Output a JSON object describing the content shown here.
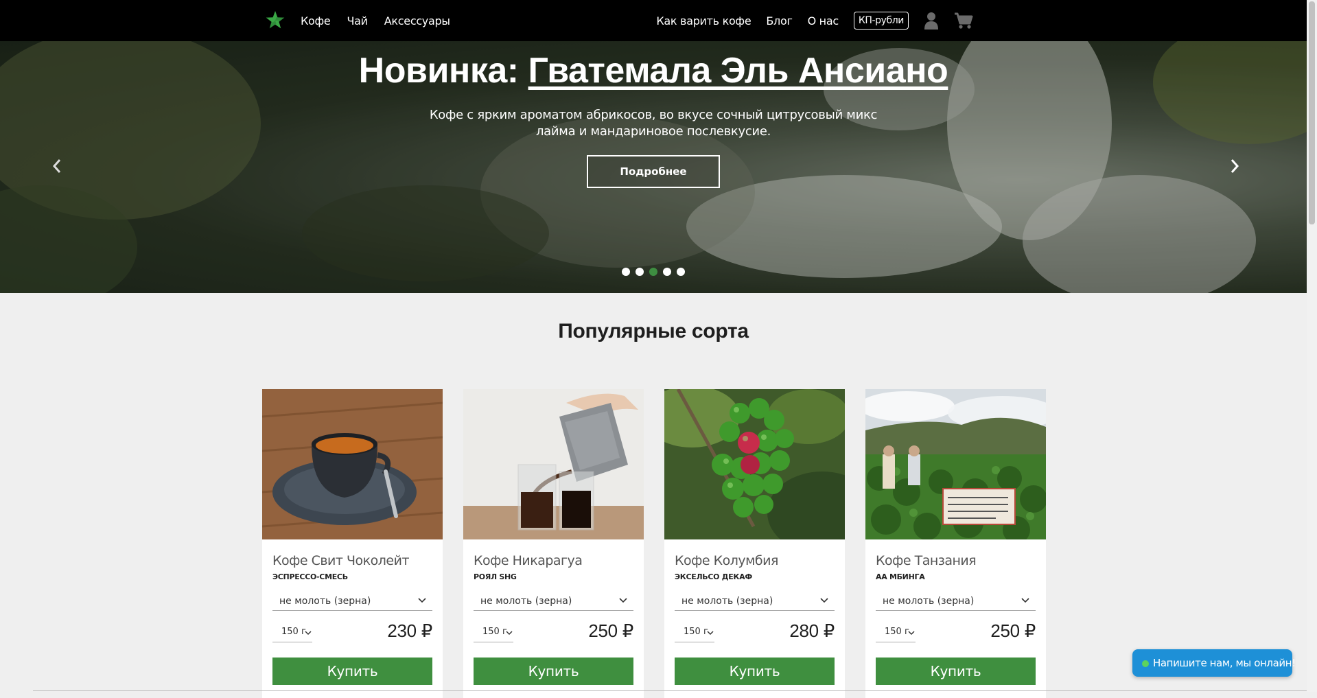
{
  "header": {
    "nav_left": [
      "Кофе",
      "Чай",
      "Аксессуары"
    ],
    "nav_right": [
      "Как варить кофе",
      "Блог",
      "О нас"
    ],
    "currency_label": "КП-рубли",
    "logo_icon": "green-leaf-star-icon",
    "account_icon": "user-icon",
    "cart_icon": "cart-icon"
  },
  "hero": {
    "title_prefix": "Новинка:",
    "title_link": "Гватемала Эль Ансиано",
    "description": "Кофе с ярким ароматом абрикосов, во вкусе сочный цитрусовый микс лайма и мандариновое послевкусие.",
    "button_label": "Подробнее",
    "slides_total": 5,
    "active_slide": 3,
    "prev_icon": "chevron-left-icon",
    "next_icon": "chevron-right-icon"
  },
  "popular": {
    "title": "Популярные сорта",
    "products": [
      {
        "name": "Кофе Свит Чоколейт",
        "subtitle": "ЭСПРЕССО-СМЕСЬ",
        "grind": "не молоть (зерна)",
        "weight": "150 г",
        "price": "230 ₽",
        "buy_label": "Купить",
        "image": "espresso-cup-photo"
      },
      {
        "name": "Кофе Никарагуа",
        "subtitle": "РОЯЛ SHG",
        "grind": "не молоть (зерна)",
        "weight": "150 г",
        "price": "250 ₽",
        "buy_label": "Купить",
        "image": "french-press-pour-photo"
      },
      {
        "name": "Кофе Колумбия",
        "subtitle": "ЭКСЕЛЬСО ДЕКАФ",
        "grind": "не молоть (зерна)",
        "weight": "150 г",
        "price": "280 ₽",
        "buy_label": "Купить",
        "image": "coffee-cherries-photo"
      },
      {
        "name": "Кофе Танзания",
        "subtitle": "АА МБИНГА",
        "grind": "не молоть (зерна)",
        "weight": "150 г",
        "price": "250 ₽",
        "buy_label": "Купить",
        "image": "plantation-field-photo"
      }
    ]
  },
  "chat": {
    "label": "Напишите нам, мы онлайн!"
  },
  "colors": {
    "accent_green": "#3f8f3f",
    "header_bg": "#000000",
    "page_bg": "#efefef",
    "chat_blue": "#1e90d7"
  }
}
